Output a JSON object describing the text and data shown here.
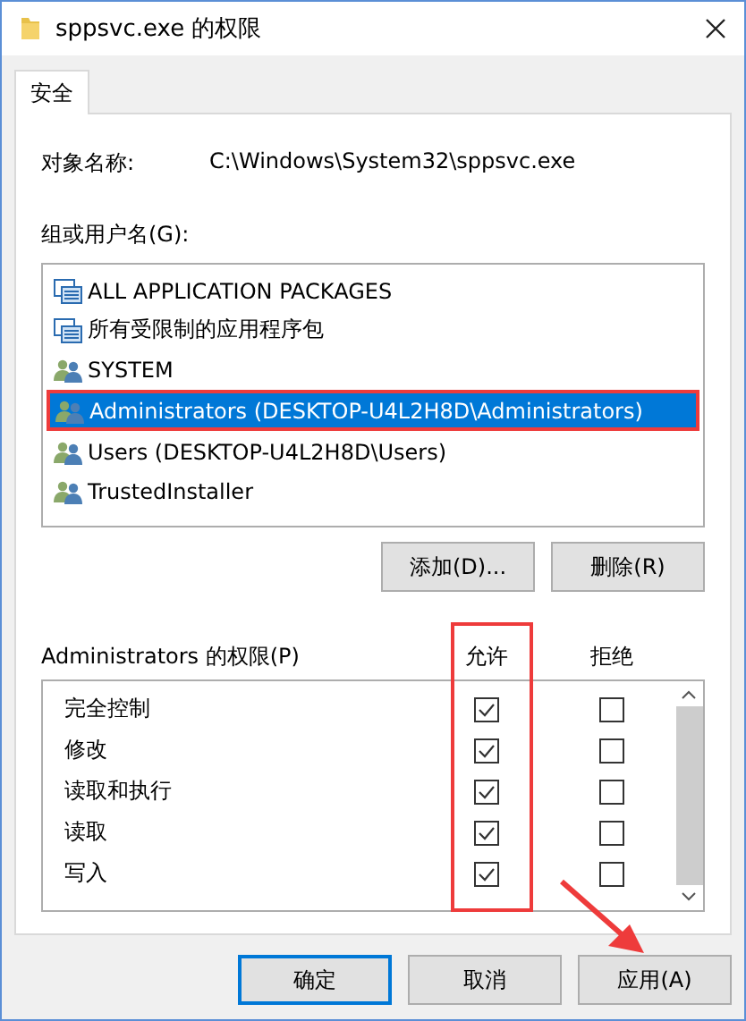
{
  "window": {
    "title": "sppsvc.exe 的权限"
  },
  "tabs": [
    {
      "label": "安全",
      "selected": true
    }
  ],
  "object_name": {
    "label": "对象名称:",
    "value": "C:\\Windows\\System32\\sppsvc.exe"
  },
  "principals": {
    "label": "组或用户名(G):",
    "items": [
      {
        "kind": "package",
        "name": "ALL APPLICATION PACKAGES",
        "selected": false,
        "outlined": false
      },
      {
        "kind": "package",
        "name": "所有受限制的应用程序包",
        "selected": false,
        "outlined": false
      },
      {
        "kind": "group",
        "name": "SYSTEM",
        "selected": false,
        "outlined": false
      },
      {
        "kind": "group",
        "name": "Administrators (DESKTOP-U4L2H8D\\Administrators)",
        "selected": true,
        "outlined": true
      },
      {
        "kind": "group",
        "name": "Users (DESKTOP-U4L2H8D\\Users)",
        "selected": false,
        "outlined": false
      },
      {
        "kind": "group",
        "name": "TrustedInstaller",
        "selected": false,
        "outlined": false
      }
    ],
    "buttons": [
      "添加(D)...",
      "删除(R)"
    ]
  },
  "permissions": {
    "label": "Administrators 的权限(P)",
    "allow_header": "允许",
    "deny_header": "拒绝",
    "allow_outlined": true,
    "rows": [
      {
        "name": "完全控制",
        "allow": true,
        "deny": false
      },
      {
        "name": "修改",
        "allow": true,
        "deny": false
      },
      {
        "name": "读取和执行",
        "allow": true,
        "deny": false
      },
      {
        "name": "读取",
        "allow": true,
        "deny": false
      },
      {
        "name": "写入",
        "allow": true,
        "deny": false
      }
    ]
  },
  "footer_buttons": [
    {
      "label": "确定",
      "default": true
    },
    {
      "label": "取消",
      "default": false
    },
    {
      "label": "应用(A)",
      "default": false,
      "pointed": true
    }
  ]
}
